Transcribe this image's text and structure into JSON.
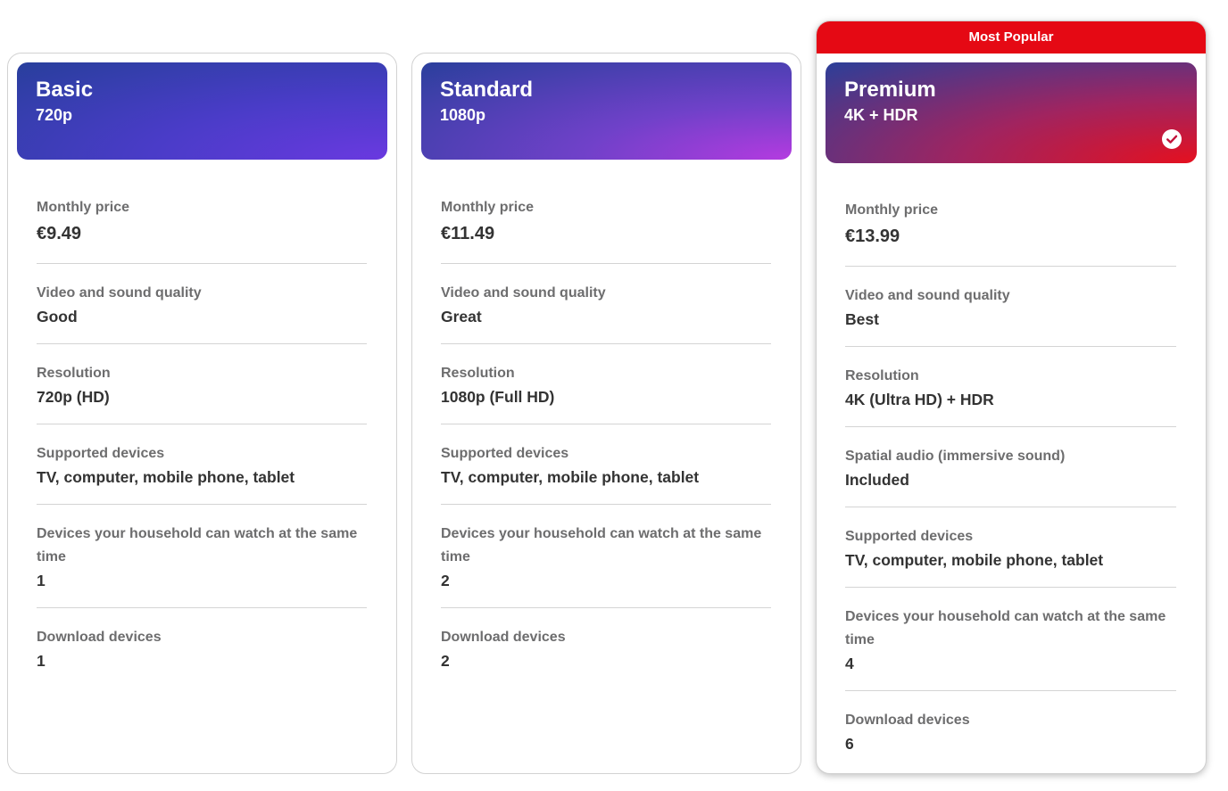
{
  "colors": {
    "accent_red": "#e50914",
    "text_label": "#6d6d6e",
    "text_value": "#333333",
    "divider": "#d4d4d4"
  },
  "plans": [
    {
      "name": "Basic",
      "resolution_short": "720p",
      "features": [
        {
          "label": "Monthly price",
          "value": "€9.49"
        },
        {
          "label": "Video and sound quality",
          "value": "Good"
        },
        {
          "label": "Resolution",
          "value": "720p (HD)"
        },
        {
          "label": "Supported devices",
          "value": "TV, computer, mobile phone, tablet"
        },
        {
          "label": "Devices your household can watch at the same time",
          "value": "1"
        },
        {
          "label": "Download devices",
          "value": "1"
        }
      ]
    },
    {
      "name": "Standard",
      "resolution_short": "1080p",
      "features": [
        {
          "label": "Monthly price",
          "value": "€11.49"
        },
        {
          "label": "Video and sound quality",
          "value": "Great"
        },
        {
          "label": "Resolution",
          "value": "1080p (Full HD)"
        },
        {
          "label": "Supported devices",
          "value": "TV, computer, mobile phone, tablet"
        },
        {
          "label": "Devices your household can watch at the same time",
          "value": "2"
        },
        {
          "label": "Download devices",
          "value": "2"
        }
      ]
    },
    {
      "name": "Premium",
      "resolution_short": "4K + HDR",
      "badge": "Most Popular",
      "selected": true,
      "selected_icon": "check-circle-icon",
      "features": [
        {
          "label": "Monthly price",
          "value": "€13.99"
        },
        {
          "label": "Video and sound quality",
          "value": "Best"
        },
        {
          "label": "Resolution",
          "value": "4K (Ultra HD) + HDR"
        },
        {
          "label": "Spatial audio (immersive sound)",
          "value": "Included"
        },
        {
          "label": "Supported devices",
          "value": "TV, computer, mobile phone, tablet"
        },
        {
          "label": "Devices your household can watch at the same time",
          "value": "4"
        },
        {
          "label": "Download devices",
          "value": "6"
        }
      ]
    }
  ]
}
